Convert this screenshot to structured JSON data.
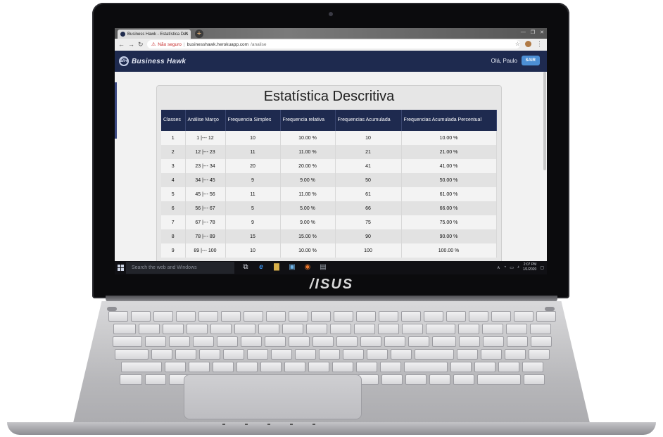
{
  "device": {
    "brand": "/ISUS"
  },
  "browser": {
    "tab_title": "Business Hawk - Estatística Des",
    "tab_close": "×",
    "new_tab": "+",
    "window_controls": [
      "—",
      "❐",
      "✕"
    ],
    "address": {
      "security_label": "Não seguro",
      "host": "businesshawk.herokuapp.com",
      "path": "/analise"
    }
  },
  "app": {
    "logo_text": "Business Hawk",
    "logo_mark": "BH",
    "greeting": "Olá, Paulo",
    "logout_label": "SAIR",
    "colors": {
      "navbar": "#1e2a4f",
      "logout_button": "#4c8fd4"
    }
  },
  "report": {
    "title": "Estatística Descritiva",
    "columns": [
      "Classes",
      "Análise Março",
      "Frequencia Simples",
      "Frequencia relativa",
      "Frequencias Acumulada",
      "Frequencias Acumulada Percentual"
    ],
    "rows": [
      [
        "1",
        "1 |--- 12",
        "10",
        "10.00 %",
        "10",
        "10.00 %"
      ],
      [
        "2",
        "12 |--- 23",
        "11",
        "11.00 %",
        "21",
        "21.00 %"
      ],
      [
        "3",
        "23 |--- 34",
        "20",
        "20.00 %",
        "41",
        "41.00 %"
      ],
      [
        "4",
        "34 |--- 45",
        "9",
        "9.00 %",
        "50",
        "50.00 %"
      ],
      [
        "5",
        "45 |--- 56",
        "11",
        "11.00 %",
        "61",
        "61.00 %"
      ],
      [
        "6",
        "56 |--- 67",
        "5",
        "5.00 %",
        "66",
        "66.00 %"
      ],
      [
        "7",
        "67 |--- 78",
        "9",
        "9.00 %",
        "75",
        "75.00 %"
      ],
      [
        "8",
        "78 |--- 89",
        "15",
        "15.00 %",
        "90",
        "90.00 %"
      ],
      [
        "9",
        "89 |--- 100",
        "10",
        "10.00 %",
        "100",
        "100.00 %"
      ]
    ]
  },
  "taskbar": {
    "search_placeholder": "Search the web and Windows",
    "clock_time": "2:07 PM",
    "clock_date": "1/1/2020"
  }
}
